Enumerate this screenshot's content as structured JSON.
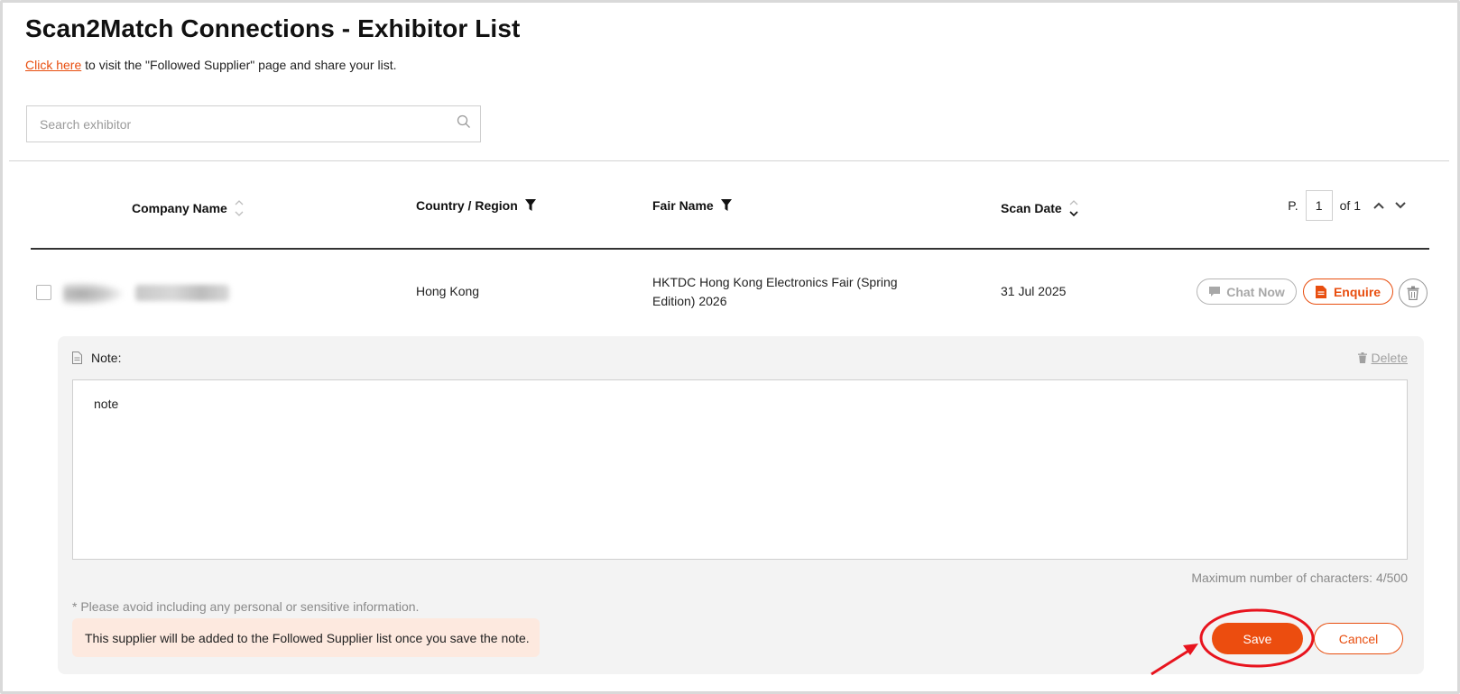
{
  "page": {
    "title": "Scan2Match Connections - Exhibitor List",
    "subline_link": "Click here",
    "subline_text": " to visit the \"Followed Supplier\" page and share your list."
  },
  "search": {
    "placeholder": "Search exhibitor",
    "value": ""
  },
  "table": {
    "headers": {
      "company": "Company Name",
      "country": "Country / Region",
      "fair": "Fair Name",
      "scan_date": "Scan Date"
    },
    "pager": {
      "prefix": "P.",
      "page": "1",
      "suffix": "of 1"
    },
    "rows": [
      {
        "country": "Hong Kong",
        "fair_line1": "HKTDC Hong Kong Electronics Fair (Spring",
        "fair_line2": "Edition) 2026",
        "scan_date": "31 Jul 2025",
        "chat_label": "Chat Now",
        "enquire_label": "Enquire"
      }
    ]
  },
  "note": {
    "label": "Note:",
    "delete_label": "Delete",
    "value": "note",
    "char_count": "Maximum number of characters: 4/500",
    "disclaimer": "* Please avoid including any personal or sensitive information.",
    "banner": "This supplier will be added to the Followed Supplier list once you save the note.",
    "save_label": "Save",
    "cancel_label": "Cancel"
  },
  "colors": {
    "accent": "#e84e0f",
    "save_bg": "#ec4d0f",
    "banner_bg": "#fde9df",
    "annotation_red": "#e8141e"
  },
  "icons": {
    "search": "search-icon",
    "sort": "sort-icon",
    "filter": "filter-icon",
    "chat": "chat-bubble-icon",
    "enquire": "document-icon",
    "trash": "trash-icon",
    "note": "note-document-icon"
  }
}
